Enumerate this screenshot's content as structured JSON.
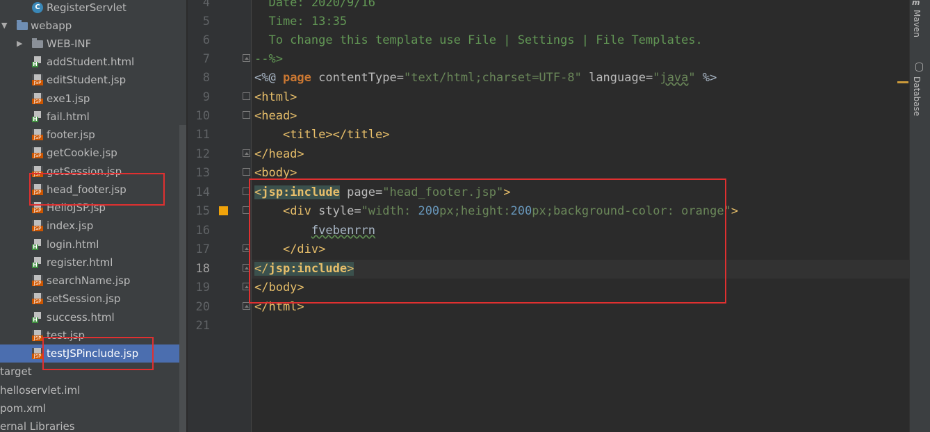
{
  "project_tree": {
    "items": [
      {
        "label": "RegisterServlet",
        "icon": "java-class-icon"
      },
      {
        "label": "webapp",
        "icon": "folder-icon",
        "expanded": true
      },
      {
        "label": "WEB-INF",
        "icon": "folder-icon",
        "expanded": false
      },
      {
        "label": "addStudent.html",
        "icon": "html-file-icon"
      },
      {
        "label": "editStudent.jsp",
        "icon": "jsp-file-icon"
      },
      {
        "label": "exe1.jsp",
        "icon": "jsp-file-icon"
      },
      {
        "label": "fail.html",
        "icon": "html-file-icon"
      },
      {
        "label": "footer.jsp",
        "icon": "jsp-file-icon"
      },
      {
        "label": "getCookie.jsp",
        "icon": "jsp-file-icon"
      },
      {
        "label": "getSession.jsp",
        "icon": "jsp-file-icon"
      },
      {
        "label": "head_footer.jsp",
        "icon": "jsp-file-icon"
      },
      {
        "label": "HelloJSP.jsp",
        "icon": "jsp-file-icon"
      },
      {
        "label": "index.jsp",
        "icon": "jsp-file-icon"
      },
      {
        "label": "login.html",
        "icon": "html-file-icon"
      },
      {
        "label": "register.html",
        "icon": "html-file-icon"
      },
      {
        "label": "searchName.jsp",
        "icon": "jsp-file-icon"
      },
      {
        "label": "setSession.jsp",
        "icon": "jsp-file-icon"
      },
      {
        "label": "success.html",
        "icon": "html-file-icon"
      },
      {
        "label": "test.jsp",
        "icon": "jsp-file-icon"
      },
      {
        "label": "testJSPinclude.jsp",
        "icon": "jsp-file-icon",
        "selected": true
      },
      {
        "label": "target",
        "icon": "folder-icon"
      },
      {
        "label": "helloservlet.iml",
        "icon": "iml-file-icon"
      },
      {
        "label": "pom.xml",
        "icon": "maven-file-icon"
      },
      {
        "label": "ernal Libraries",
        "icon": "libraries-icon"
      }
    ]
  },
  "editor": {
    "line_numbers": [
      "4",
      "5",
      "6",
      "7",
      "8",
      "9",
      "10",
      "11",
      "12",
      "13",
      "14",
      "15",
      "16",
      "17",
      "18",
      "19",
      "20",
      "21"
    ],
    "current_line": "18",
    "lines": {
      "l4": "  Date: 2020/9/16",
      "l5": "  Time: 13:35",
      "l6": "  To change this template use File | Settings | File Templates.",
      "l7": "--%>",
      "l8": {
        "p1": "<%@ ",
        "p2": "page",
        "p3": " contentType=",
        "p4": "\"text/html;charset=UTF-8\"",
        "p5": " language=",
        "p6": "\"",
        "p7": "java",
        "p8": "\"",
        "p9": " %>"
      },
      "l9": "<html>",
      "l10": "<head>",
      "l11": {
        "indent": "    ",
        "t1": "<title></title>"
      },
      "l12": "</head>",
      "l13": "<body>",
      "l14": {
        "t1": "<",
        "t2": "jsp:include",
        "t3": " page=",
        "t4": "\"head_footer.jsp\"",
        "t5": ">"
      },
      "l15": {
        "indent": "    ",
        "t1": "<div",
        "t2": " style=",
        "t3": "\"width: ",
        "t4": "200",
        "t5": "px;height:",
        "t6": "200",
        "t7": "px;background-color: orange\"",
        "t8": ">"
      },
      "l16": {
        "indent": "        ",
        "t1": "fvebenrrn"
      },
      "l17": {
        "indent": "    ",
        "t1": "</div>"
      },
      "l18": {
        "t1": "</",
        "t2": "jsp:include",
        "t3": ">"
      },
      "l19": "</body>",
      "l20": "</html>"
    }
  },
  "right_toolbar": {
    "maven": "Maven",
    "database": "Database"
  },
  "colors": {
    "highlight_box": "#e03030",
    "editor_bg": "#2b2b2b",
    "selection": "#4b6eaf"
  }
}
